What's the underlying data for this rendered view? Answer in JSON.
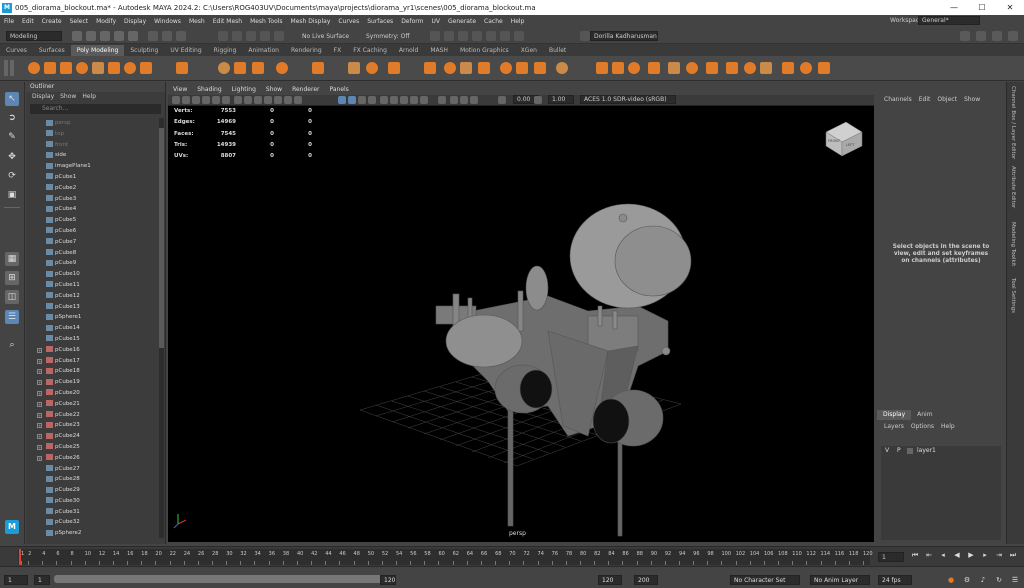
{
  "window": {
    "title": "005_diorama_blockout.ma* - Autodesk MAYA 2024.2: C:\\Users\\ROG403UV\\Documents\\maya\\projects\\diorama_yr1\\scenes\\005_diorama_blockout.ma",
    "logo": "M",
    "min": "—",
    "max": "☐",
    "close": "✕"
  },
  "menu": [
    "File",
    "Edit",
    "Create",
    "Select",
    "Modify",
    "Display",
    "Windows",
    "Mesh",
    "Edit Mesh",
    "Mesh Tools",
    "Mesh Display",
    "Curves",
    "Surfaces",
    "Deform",
    "UV",
    "Generate",
    "Cache",
    "Help"
  ],
  "workspace": {
    "label": "Workspace:",
    "value": "General*"
  },
  "statusline": {
    "mode": "Modeling",
    "live_surface": "No Live Surface",
    "symmetry": "Symmetry: Off",
    "user": "Dorilla Kadharusman"
  },
  "shelf_tabs": [
    "Curves",
    "Surfaces",
    "Poly Modeling",
    "Sculpting",
    "UV Editing",
    "Rigging",
    "Animation",
    "Rendering",
    "FX",
    "FX Caching",
    "Arnold",
    "MASH",
    "Motion Graphics",
    "XGen",
    "Bullet"
  ],
  "shelf_active": "Poly Modeling",
  "outliner": {
    "title": "Outliner",
    "menu": [
      "Display",
      "Show",
      "Help"
    ],
    "search_placeholder": "Search...",
    "items": [
      {
        "name": "persp",
        "dim": true,
        "exp": false
      },
      {
        "name": "top",
        "dim": true,
        "exp": false
      },
      {
        "name": "front",
        "dim": true,
        "exp": false
      },
      {
        "name": "side",
        "dim": false,
        "exp": false
      },
      {
        "name": "imagePlane1",
        "dim": false,
        "exp": false
      },
      {
        "name": "pCube1",
        "dim": false,
        "exp": false
      },
      {
        "name": "pCube2",
        "dim": false,
        "exp": false
      },
      {
        "name": "pCube3",
        "dim": false,
        "exp": false
      },
      {
        "name": "pCube4",
        "dim": false,
        "exp": false
      },
      {
        "name": "pCube5",
        "dim": false,
        "exp": false
      },
      {
        "name": "pCube6",
        "dim": false,
        "exp": false
      },
      {
        "name": "pCube7",
        "dim": false,
        "exp": false
      },
      {
        "name": "pCube8",
        "dim": false,
        "exp": false
      },
      {
        "name": "pCube9",
        "dim": false,
        "exp": false
      },
      {
        "name": "pCube10",
        "dim": false,
        "exp": false
      },
      {
        "name": "pCube11",
        "dim": false,
        "exp": false
      },
      {
        "name": "pCube12",
        "dim": false,
        "exp": false
      },
      {
        "name": "pCube13",
        "dim": false,
        "exp": false
      },
      {
        "name": "pSphere1",
        "dim": false,
        "exp": false
      },
      {
        "name": "pCube14",
        "dim": false,
        "exp": false
      },
      {
        "name": "pCube15",
        "dim": false,
        "exp": false
      },
      {
        "name": "pCube16",
        "dim": false,
        "exp": true
      },
      {
        "name": "pCube17",
        "dim": false,
        "exp": true
      },
      {
        "name": "pCube18",
        "dim": false,
        "exp": true
      },
      {
        "name": "pCube19",
        "dim": false,
        "exp": true
      },
      {
        "name": "pCube20",
        "dim": false,
        "exp": true
      },
      {
        "name": "pCube21",
        "dim": false,
        "exp": true
      },
      {
        "name": "pCube22",
        "dim": false,
        "exp": true
      },
      {
        "name": "pCube23",
        "dim": false,
        "exp": true
      },
      {
        "name": "pCube24",
        "dim": false,
        "exp": true
      },
      {
        "name": "pCube25",
        "dim": false,
        "exp": true
      },
      {
        "name": "pCube26",
        "dim": false,
        "exp": true
      },
      {
        "name": "pCube27",
        "dim": false,
        "exp": false
      },
      {
        "name": "pCube28",
        "dim": false,
        "exp": false
      },
      {
        "name": "pCube29",
        "dim": false,
        "exp": false
      },
      {
        "name": "pCube30",
        "dim": false,
        "exp": false
      },
      {
        "name": "pCube31",
        "dim": false,
        "exp": false
      },
      {
        "name": "pCube32",
        "dim": false,
        "exp": false
      },
      {
        "name": "pSphere2",
        "dim": false,
        "exp": false
      }
    ]
  },
  "viewport": {
    "menu": [
      "View",
      "Shading",
      "Lighting",
      "Show",
      "Renderer",
      "Panels"
    ],
    "field_a": "0.00",
    "field_b": "1.00",
    "colorspace": "ACES 1.0 SDR-video (sRGB)",
    "camera": "persp",
    "cube_labels": {
      "front": "FRONT",
      "right": "LEFT"
    },
    "hud": [
      {
        "label": "Verts:",
        "a": "7553",
        "b": "0",
        "c": "0"
      },
      {
        "label": "Edges:",
        "a": "14969",
        "b": "0",
        "c": "0"
      },
      {
        "label": "Faces:",
        "a": "7545",
        "b": "0",
        "c": "0"
      },
      {
        "label": "Tris:",
        "a": "14939",
        "b": "0",
        "c": "0"
      },
      {
        "label": "UVs:",
        "a": "8807",
        "b": "0",
        "c": "0"
      }
    ]
  },
  "channelbox": {
    "menu": [
      "Channels",
      "Edit",
      "Object",
      "Show"
    ],
    "message": "Select objects in the scene to view, edit and set keyframes on channels (attributes)"
  },
  "layers": {
    "tabs": [
      "Display",
      "Anim"
    ],
    "menu": [
      "Layers",
      "Options",
      "Help"
    ],
    "layer_v": "V",
    "layer_p": "P",
    "layer_name": "layer1"
  },
  "right_tabs": [
    "Channel Box / Layer Editor",
    "Attribute Editor",
    "Modeling Toolkit",
    "Tool Settings"
  ],
  "timeline": {
    "ticks": [
      "1",
      "2",
      "4",
      "6",
      "8",
      "10",
      "12",
      "14",
      "16",
      "18",
      "20",
      "22",
      "24",
      "26",
      "28",
      "30",
      "32",
      "34",
      "36",
      "38",
      "40",
      "42",
      "44",
      "46",
      "48",
      "50",
      "52",
      "54",
      "56",
      "58",
      "60",
      "62",
      "64",
      "66",
      "68",
      "70",
      "72",
      "74",
      "76",
      "78",
      "80",
      "82",
      "84",
      "86",
      "88",
      "90",
      "92",
      "94",
      "96",
      "98",
      "100",
      "102",
      "104",
      "106",
      "108",
      "110",
      "112",
      "114",
      "116",
      "118",
      "120"
    ],
    "current_frame": "1"
  },
  "range": {
    "start": "1",
    "start_inner": "1",
    "end_inner": "120",
    "end": "120",
    "anim_end": "200",
    "character_set": "No Character Set",
    "anim_layer": "No Anim Layer",
    "fps": "24 fps"
  },
  "colors": {
    "accent_blue": "#1a9cd6",
    "shelf_orange": "#e07b2a",
    "viewport_bg": "#000000"
  }
}
